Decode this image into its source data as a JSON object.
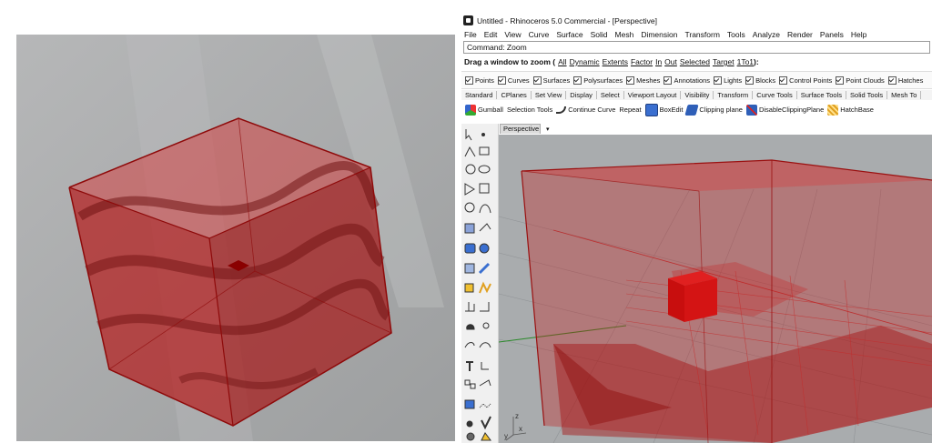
{
  "rhino": {
    "title": "Untitled - Rhinoceros 5.0 Commercial - [Perspective]",
    "menu": [
      "File",
      "Edit",
      "View",
      "Curve",
      "Surface",
      "Solid",
      "Mesh",
      "Dimension",
      "Transform",
      "Tools",
      "Analyze",
      "Render",
      "Panels",
      "Help"
    ],
    "command_line": "Command: Zoom",
    "prompt_lead": "Drag a window to zoom (",
    "prompt_options": [
      "All",
      "Dynamic",
      "Extents",
      "Factor",
      "In",
      "Out",
      "Selected",
      "Target",
      "1To1"
    ],
    "prompt_tail": "):",
    "osnap_filters": [
      "Points",
      "Curves",
      "Surfaces",
      "Polysurfaces",
      "Meshes",
      "Annotations",
      "Lights",
      "Blocks",
      "Control Points",
      "Point Clouds",
      "Hatches"
    ],
    "tabs": [
      "Standard",
      "CPlanes",
      "Set View",
      "Display",
      "Select",
      "Viewport Layout",
      "Visibility",
      "Transform",
      "Curve Tools",
      "Surface Tools",
      "Solid Tools",
      "Mesh To"
    ],
    "toolbar": [
      {
        "label": "Gumball",
        "icon": "gumball-icon"
      },
      {
        "label": "Selection Tools",
        "icon": "selection-icon"
      },
      {
        "label": "Continue Curve",
        "icon": "curve-icon"
      },
      {
        "label": "Repeat",
        "icon": "repeat-icon"
      },
      {
        "label": "BoxEdit",
        "icon": "boxedit-icon"
      },
      {
        "label": "Clipping plane",
        "icon": "clipping-plane-icon"
      },
      {
        "label": "DisableClippingPlane",
        "icon": "disable-clipping-icon"
      },
      {
        "label": "HatchBase",
        "icon": "hatch-icon"
      }
    ],
    "viewport_label": "Perspective",
    "axis_labels": {
      "x": "x",
      "y": "y",
      "z": "z"
    }
  },
  "colors": {
    "cube_red": "#c41a1a",
    "viewport_bg": "#a9acae",
    "render_bg": "#a4a6a7",
    "grid": "#8a8d90"
  }
}
